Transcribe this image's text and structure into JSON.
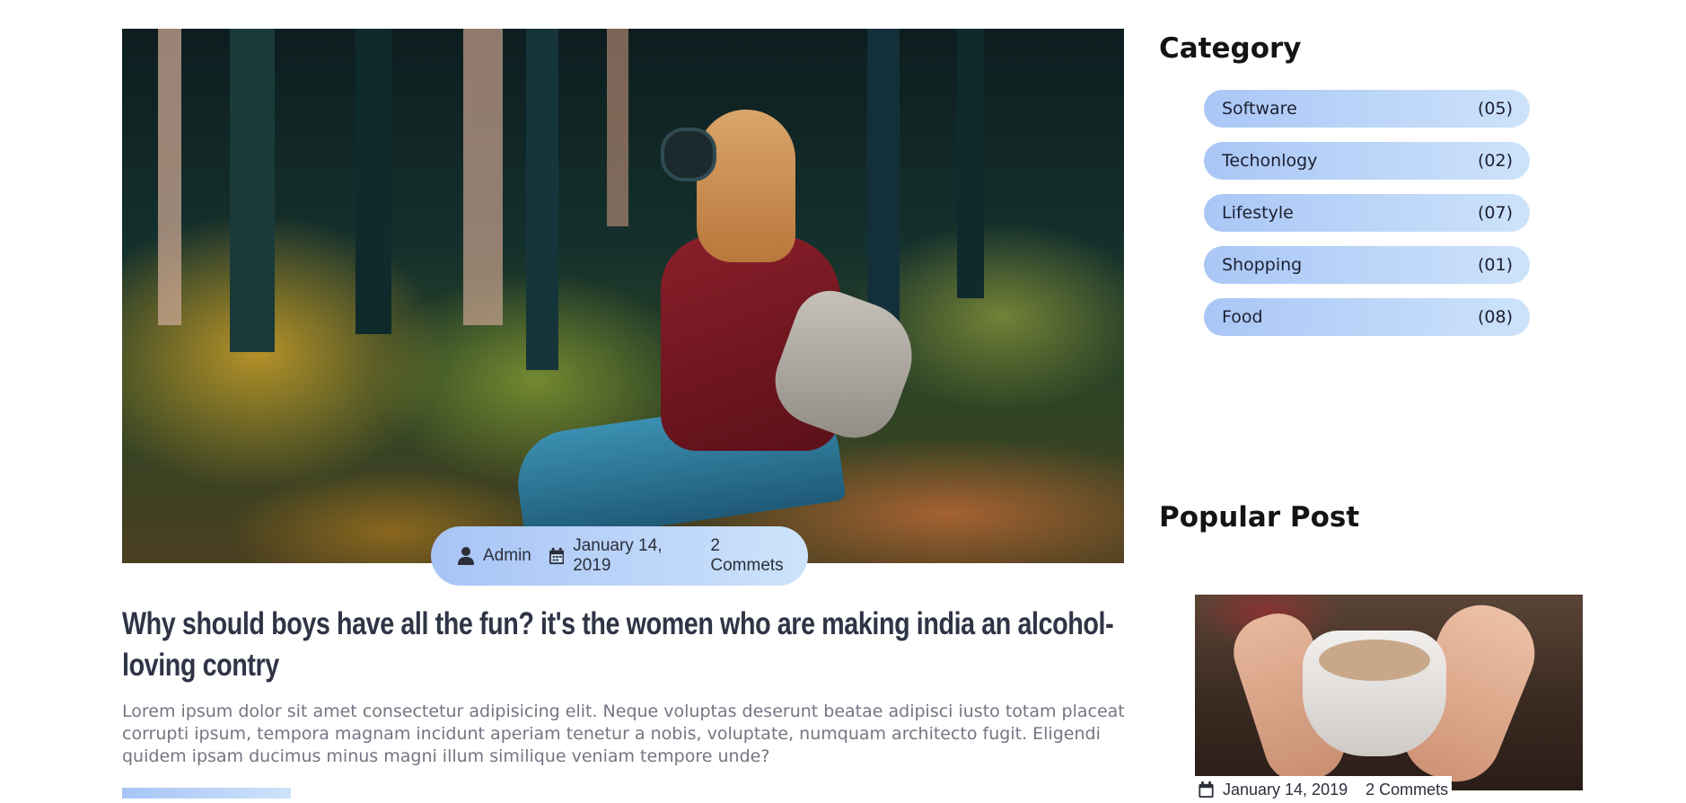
{
  "post": {
    "meta": {
      "author": "Admin",
      "date": "January 14, 2019",
      "comments": "2 Commets"
    },
    "title": "Why should boys have all the fun? it's the women who are making india an alcohol-loving contry",
    "excerpt": "Lorem ipsum dolor sit amet consectetur adipisicing elit. Neque voluptas deserunt beatae adipisci iusto totam placeat corrupti ipsum, tempora magnam incidunt aperiam tenetur a nobis, voluptate, numquam architecto fugit. Eligendi quidem ipsam ducimus minus magni illum similique veniam tempore unde?"
  },
  "sidebar": {
    "category_heading": "Category",
    "categories": [
      {
        "name": "Software",
        "count": "(05)"
      },
      {
        "name": "Techonlogy",
        "count": "(02)"
      },
      {
        "name": "Lifestyle",
        "count": "(07)"
      },
      {
        "name": "Shopping",
        "count": "(01)"
      },
      {
        "name": "Food",
        "count": "(08)"
      }
    ],
    "popular_heading": "Popular Post",
    "popular": {
      "date": "January 14, 2019",
      "comments": "2 Commets"
    }
  },
  "icons": {
    "author": "user-icon",
    "date": "calendar-icon"
  },
  "colors": {
    "pill_start": "#a7c4f6",
    "pill_end": "#cde3fb",
    "title": "#2f3446",
    "excerpt": "#737682"
  }
}
